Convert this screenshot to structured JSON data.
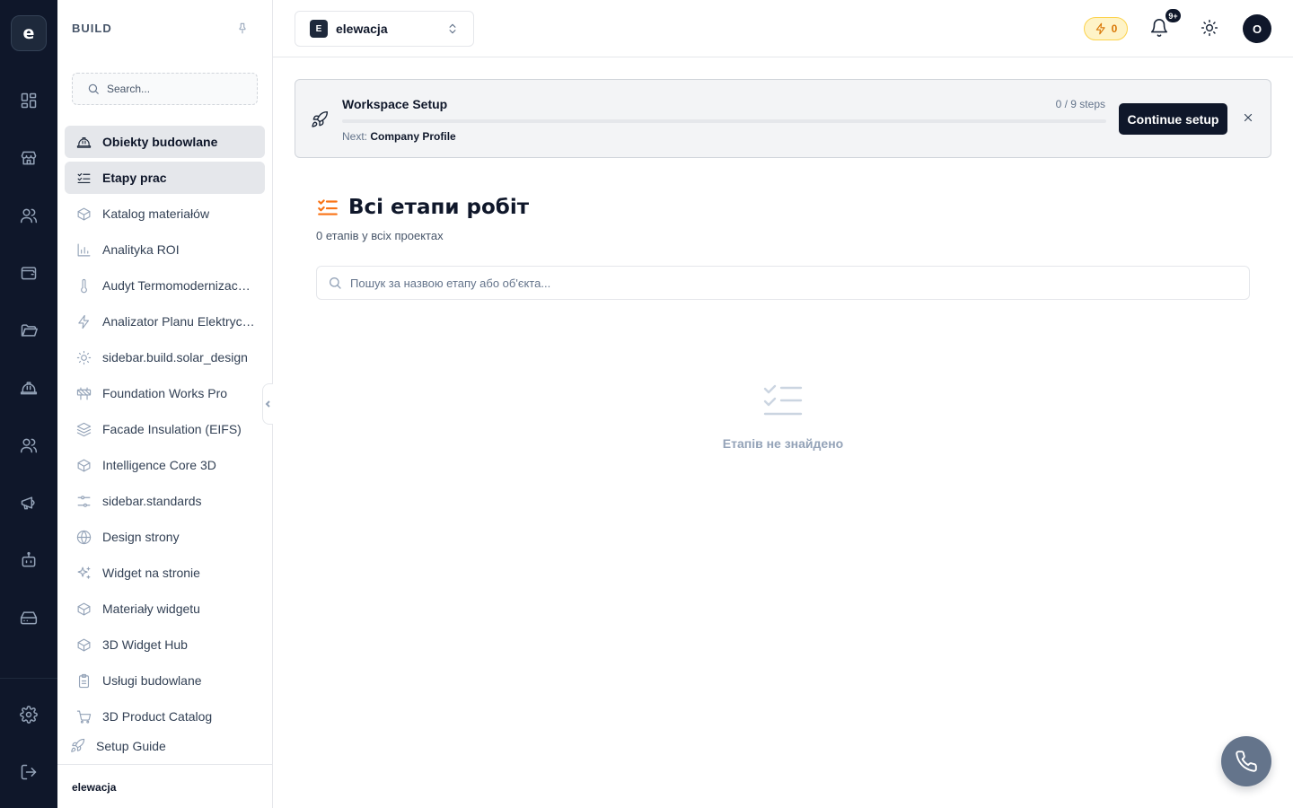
{
  "rail": {
    "logo": "e",
    "icons": [
      "dashboard-icon",
      "store-icon",
      "users-icon",
      "wallet-icon",
      "folder-icon",
      "hardhat-icon",
      "team-icon",
      "megaphone-icon",
      "bot-icon",
      "drive-icon",
      "settings-icon",
      "logout-icon"
    ]
  },
  "sidebar": {
    "title": "BUILD",
    "search_placeholder": "Search...",
    "items": [
      {
        "label": "Obiekty budowlane",
        "icon": "hardhat-icon",
        "active": true
      },
      {
        "label": "Etapy prac",
        "icon": "list-checks-icon",
        "active": true
      },
      {
        "label": "Katalog materiałów",
        "icon": "box-icon"
      },
      {
        "label": "Analityka ROI",
        "icon": "bar-chart-icon"
      },
      {
        "label": "Audyt Termomodernizacyjny",
        "icon": "thermometer-icon"
      },
      {
        "label": "Analizator Planu Elektrycznego",
        "icon": "zap-icon"
      },
      {
        "label": "sidebar.build.solar_design",
        "icon": "sun-icon"
      },
      {
        "label": "Foundation Works Pro",
        "icon": "construction-icon"
      },
      {
        "label": "Facade Insulation (EIFS)",
        "icon": "layers-icon"
      },
      {
        "label": "Intelligence Core 3D",
        "icon": "box-icon"
      },
      {
        "label": "sidebar.standards",
        "icon": "sliders-icon"
      },
      {
        "label": "Design strony",
        "icon": "globe-icon"
      },
      {
        "label": "Widget na stronie",
        "icon": "sparkles-icon"
      },
      {
        "label": "Materiały widgetu",
        "icon": "box-icon"
      },
      {
        "label": "3D Widget Hub",
        "icon": "box-icon"
      },
      {
        "label": "Usługi budowlane",
        "icon": "clipboard-icon"
      },
      {
        "label": "3D Product Catalog",
        "icon": "cart-icon"
      }
    ],
    "setup_guide": "Setup Guide",
    "footer": "elewacja"
  },
  "header": {
    "workspace_badge": "E",
    "workspace_name": "elewacja",
    "credits": "0",
    "notifications_badge": "9+",
    "avatar": "O"
  },
  "banner": {
    "title": "Workspace Setup",
    "steps": "0 / 9 steps",
    "progress": 0,
    "next_prefix": "Next:",
    "next_step": "Company Profile",
    "cta": "Continue setup"
  },
  "main": {
    "title": "Всі етапи робіт",
    "subtitle": "0 етапів у всіх проектах",
    "search_placeholder": "Пошук за назвою етапу або об'єкта...",
    "empty_text": "Етапів не знайдено"
  },
  "colors": {
    "rail_bg": "#0f172a",
    "accent_orange": "#f97316",
    "credits_amber": "#d97706",
    "primary": "#0f172a"
  }
}
